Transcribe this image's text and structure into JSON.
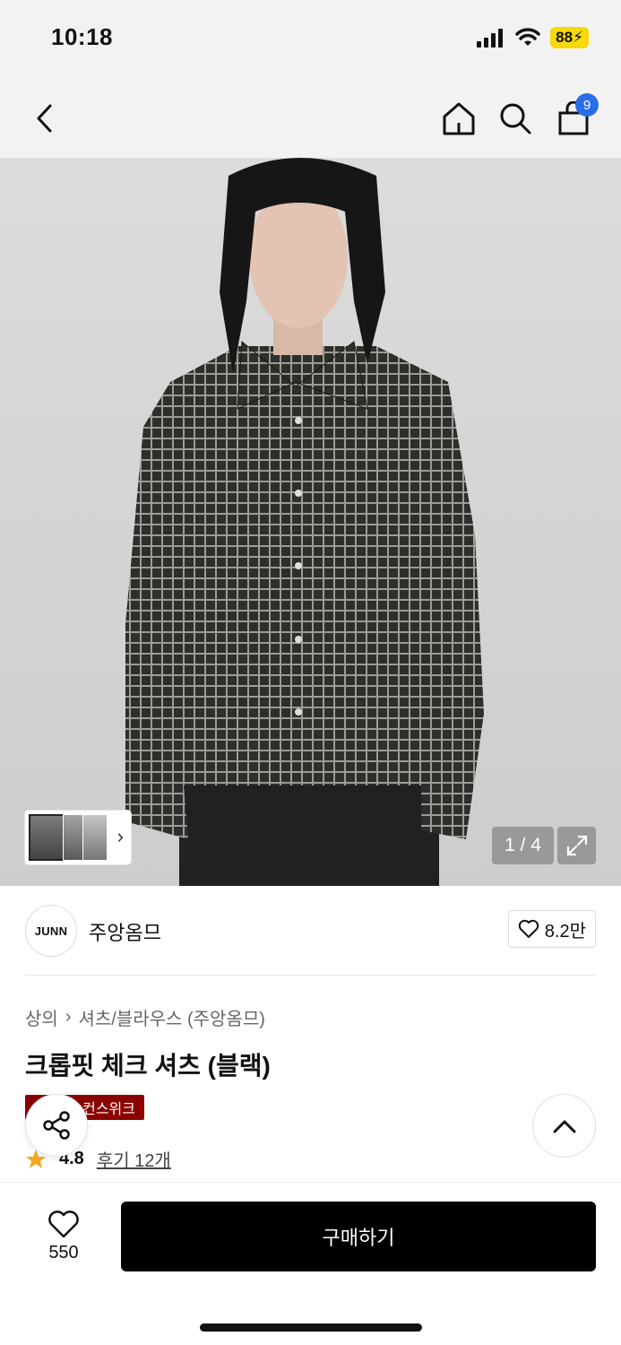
{
  "status_bar": {
    "time": "10:18",
    "battery": "88"
  },
  "nav": {
    "cart_count": "9"
  },
  "gallery": {
    "page_indicator": "1 / 4",
    "thumbnail_count": 3
  },
  "brand": {
    "logo_text": "JUNN",
    "name": "주앙옴므",
    "like_count": "8.2만"
  },
  "breadcrumb": {
    "category": "상의",
    "separator": "›",
    "subcategory": "셔츠/블라우스 (주앙옴므)"
  },
  "product": {
    "title": "크롭핏 체크 셔츠 (블랙)",
    "badge": "컨스위크",
    "rating": "4.8",
    "reviews_link": "후기 12개"
  },
  "bottom_bar": {
    "like_count": "550",
    "buy_label": "구매하기"
  },
  "colors": {
    "accent_blue": "#2a6de8",
    "badge_red": "#8b0000",
    "star": "#f5a623",
    "buy_button": "#000000"
  }
}
